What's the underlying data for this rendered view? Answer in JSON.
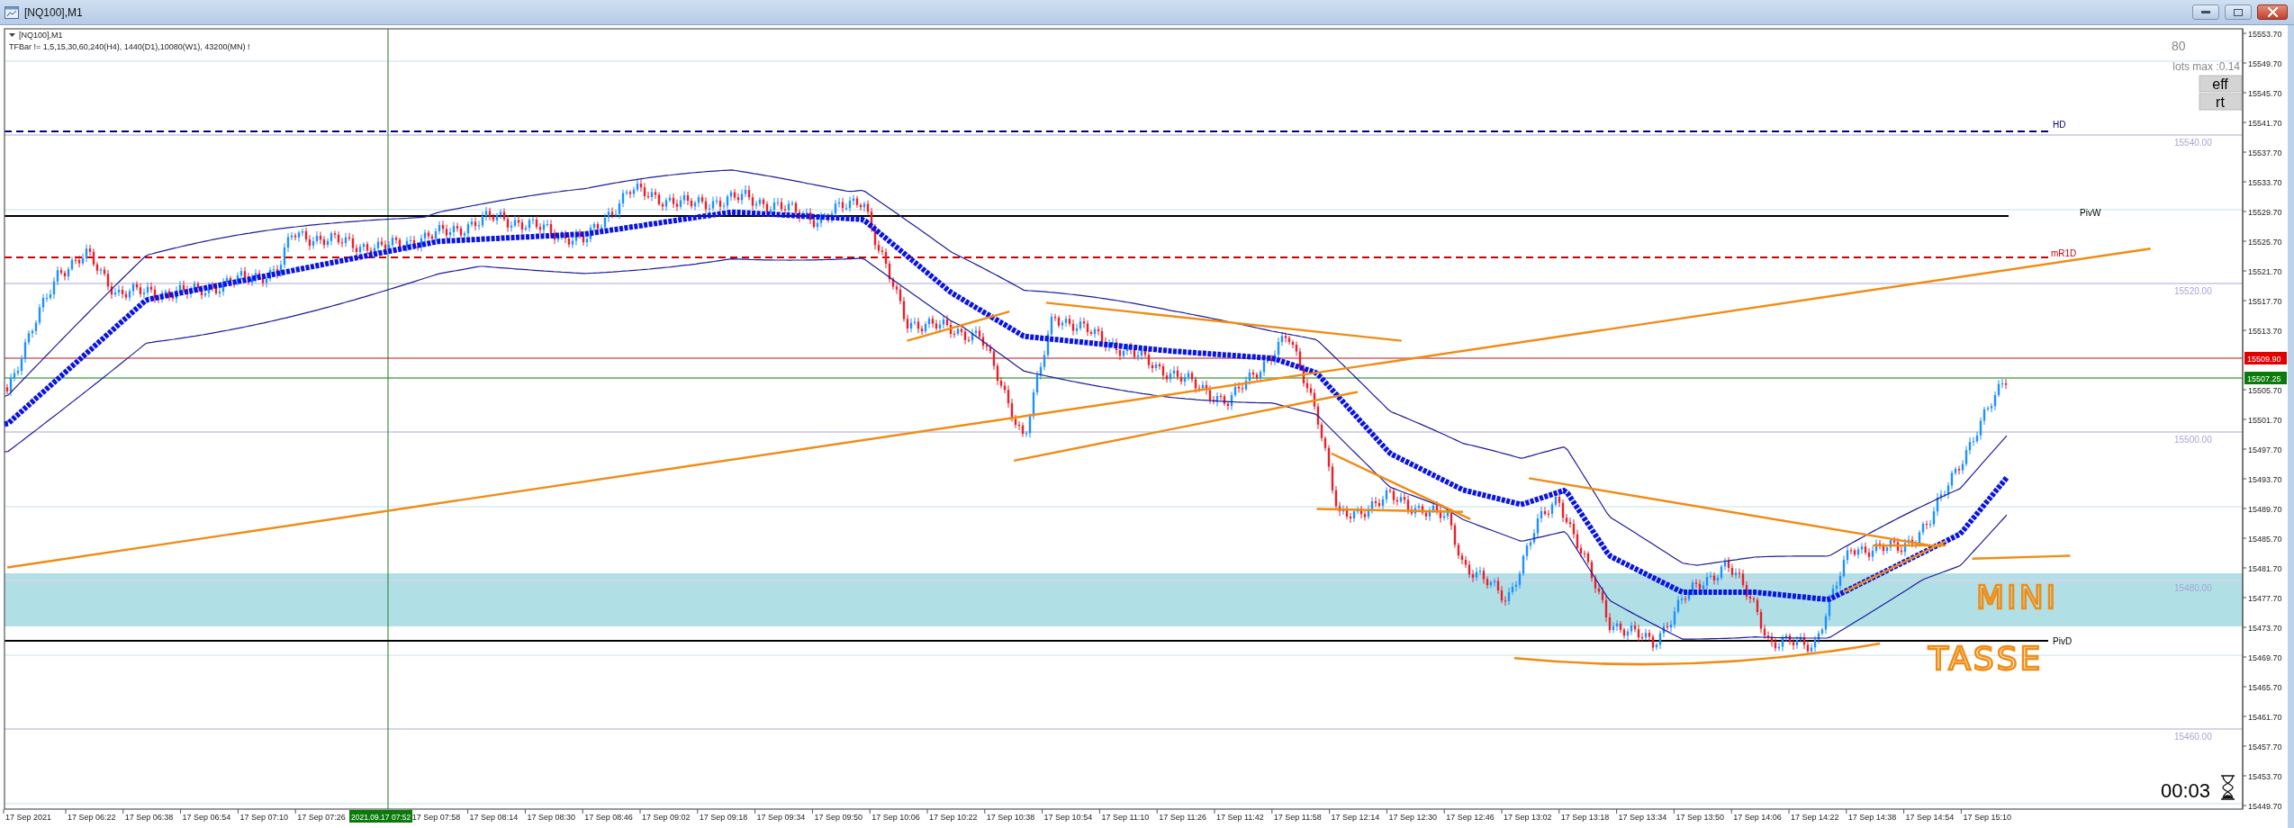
{
  "window": {
    "title": "[NQ100],M1"
  },
  "chart": {
    "symbol_label": "[NQ100],M1",
    "indicator_text": "TFBar != 1,5,15,30,60,240(H4), 1440(D1),10080(W1), 43200(MN) !",
    "levels": [
      {
        "label": "HD",
        "color": "#000080",
        "dashed": true
      },
      {
        "label": "PivW",
        "color": "#000000",
        "dashed": false
      },
      {
        "label": "mR1D",
        "color": "#cc0000",
        "dashed": true
      },
      {
        "label": "PivD",
        "color": "#000000",
        "dashed": false
      }
    ],
    "grid_labels": [
      "15540.00",
      "15520.00",
      "15500.00",
      "15480.00",
      "15460.00"
    ],
    "panel": {
      "value": "80",
      "lots": "lots max :0.14",
      "buttons": [
        "eff",
        "rt"
      ]
    },
    "countdown": "00:03",
    "note_lines": [
      "MINI",
      "TASSE"
    ],
    "crosshair_time": "2021.09.17 07:52"
  },
  "price_axis": {
    "labels": [
      "15553.70",
      "15549.70",
      "15545.70",
      "15541.70",
      "15537.70",
      "15533.70",
      "15529.70",
      "15525.70",
      "15521.70",
      "15517.70",
      "15513.70",
      "15505.70",
      "15501.70",
      "15497.70",
      "15493.70",
      "15489.70",
      "15485.70",
      "15481.70",
      "15477.70",
      "15473.70",
      "15469.70",
      "15465.70",
      "15461.70",
      "15457.70",
      "15453.70",
      "15449.70"
    ],
    "bid_tag": "15509.90",
    "last_tag": "15507.25"
  },
  "time_axis": {
    "labels": [
      "17 Sep 2021",
      "17 Sep 06:22",
      "17 Sep 06:38",
      "17 Sep 06:54",
      "17 Sep 07:10",
      "17 Sep 07:26",
      "17 Sep 07:58",
      "17 Sep 08:14",
      "17 Sep 08:30",
      "17 Sep 08:46",
      "17 Sep 09:02",
      "17 Sep 09:18",
      "17 Sep 09:34",
      "17 Sep 09:50",
      "17 Sep 10:06",
      "17 Sep 10:22",
      "17 Sep 10:38",
      "17 Sep 10:54",
      "17 Sep 11:10",
      "17 Sep 11:26",
      "17 Sep 11:42",
      "17 Sep 11:58",
      "17 Sep 12:14",
      "17 Sep 12:30",
      "17 Sep 12:46",
      "17 Sep 13:02",
      "17 Sep 13:18",
      "17 Sep 13:34",
      "17 Sep 13:50",
      "17 Sep 14:06",
      "17 Sep 14:22",
      "17 Sep 14:38",
      "17 Sep 14:54",
      "17 Sep 15:10"
    ]
  }
}
